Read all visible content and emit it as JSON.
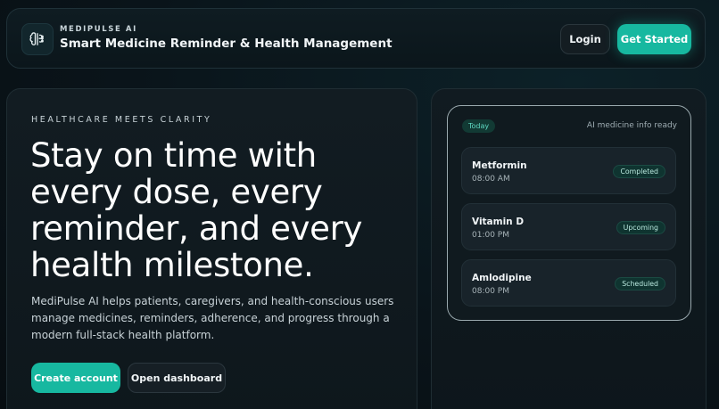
{
  "header": {
    "brand_small": "MEDIPULSE AI",
    "brand_title": "Smart Medicine Reminder & Health Management",
    "login_label": "Login",
    "get_started_label": "Get Started"
  },
  "hero": {
    "eyebrow": "HEALTHCARE MEETS CLARITY",
    "headline": "Stay on time with every dose, every reminder, and every health milestone.",
    "description": "MediPulse AI helps patients, caregivers, and health-conscious users manage medicines, reminders, adherence, and progress through a modern full-stack health platform.",
    "create_account_label": "Create account",
    "open_dashboard_label": "Open dashboard"
  },
  "schedule": {
    "today_label": "Today",
    "ai_status": "AI medicine info ready",
    "medicines": [
      {
        "name": "Metformin",
        "time": "08:00 AM",
        "status": "Completed"
      },
      {
        "name": "Vitamin D",
        "time": "01:00 PM",
        "status": "Upcoming"
      },
      {
        "name": "Amlodipine",
        "time": "08:00 PM",
        "status": "Scheduled"
      }
    ]
  },
  "colors": {
    "accent": "#17b8a0",
    "background": "#081014"
  },
  "icons": {
    "logo": "brain-icon"
  }
}
